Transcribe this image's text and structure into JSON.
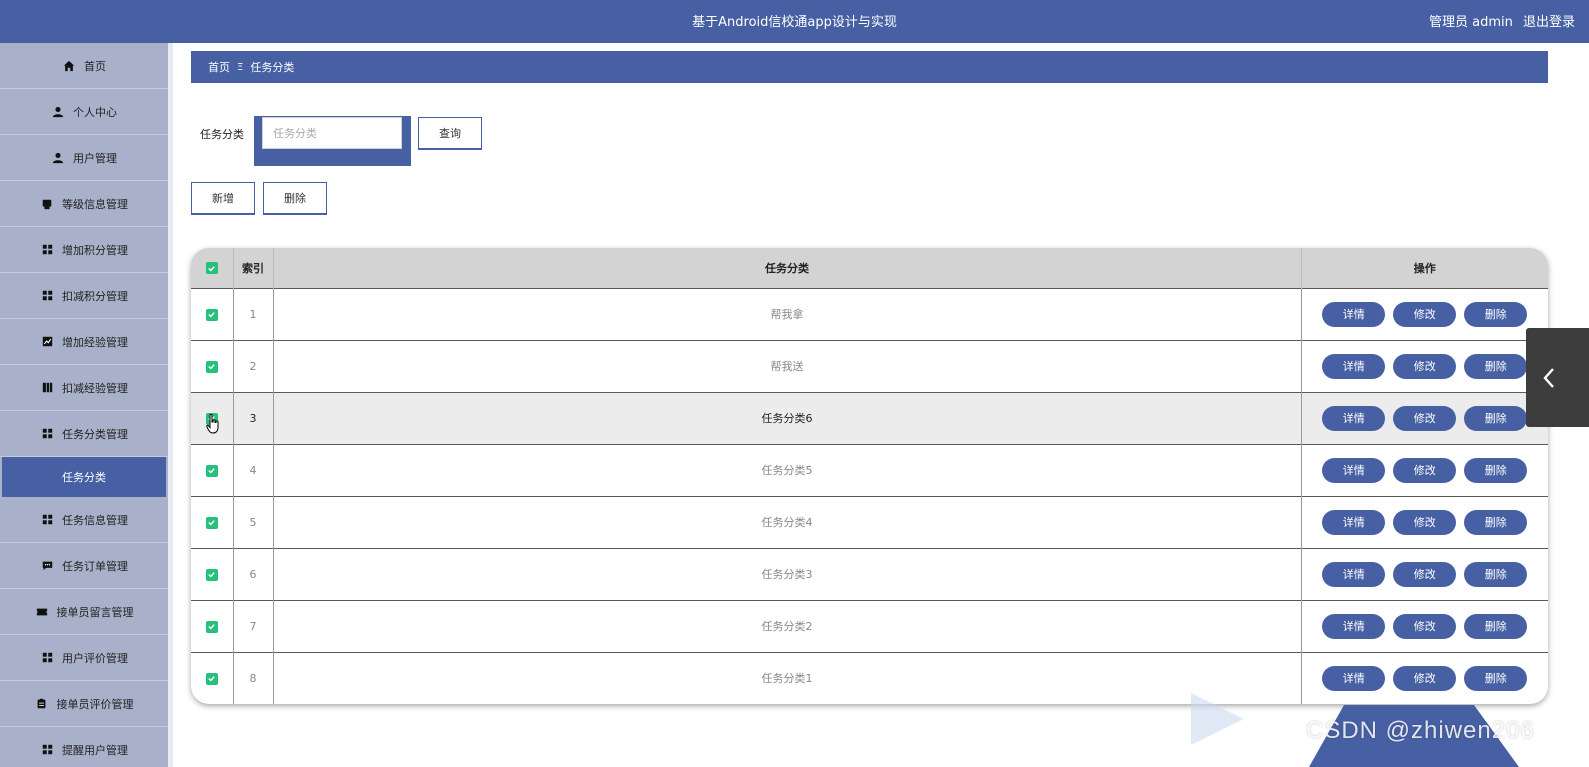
{
  "header": {
    "title": "基于Android信校通app设计与实现",
    "user_text": "管理员 admin",
    "logout": "退出登录"
  },
  "sidebar": {
    "items": [
      {
        "label": "首页",
        "icon": "home-icon"
      },
      {
        "label": "个人中心",
        "icon": "person-icon"
      },
      {
        "label": "用户管理",
        "icon": "person-icon"
      },
      {
        "label": "等级信息管理",
        "icon": "printer-icon"
      },
      {
        "label": "增加积分管理",
        "icon": "grid-icon"
      },
      {
        "label": "扣减积分管理",
        "icon": "grid-icon"
      },
      {
        "label": "增加经验管理",
        "icon": "chart-icon"
      },
      {
        "label": "扣减经验管理",
        "icon": "book-icon"
      },
      {
        "label": "任务分类管理",
        "icon": "grid-icon"
      },
      {
        "label": "任务分类",
        "icon": "",
        "active": true
      },
      {
        "label": "任务信息管理",
        "icon": "grid-icon"
      },
      {
        "label": "任务订单管理",
        "icon": "chat-icon"
      },
      {
        "label": "接单员留言管理",
        "icon": "ticket-icon"
      },
      {
        "label": "用户评价管理",
        "icon": "grid-icon"
      },
      {
        "label": "接单员评价管理",
        "icon": "clipboard-icon"
      },
      {
        "label": "提醒用户管理",
        "icon": "grid-icon"
      }
    ]
  },
  "breadcrumb": {
    "home": "首页",
    "separator": "Ξ",
    "current": "任务分类"
  },
  "search": {
    "label": "任务分类",
    "placeholder": "任务分类",
    "value": "",
    "query_button": "查询"
  },
  "toolbar": {
    "add": "新增",
    "delete": "删除"
  },
  "table": {
    "headers": {
      "index": "索引",
      "category": "任务分类",
      "ops": "操作"
    },
    "rows": [
      {
        "index": "1",
        "category": "帮我拿"
      },
      {
        "index": "2",
        "category": "帮我送"
      },
      {
        "index": "3",
        "category": "任务分类6"
      },
      {
        "index": "4",
        "category": "任务分类5"
      },
      {
        "index": "5",
        "category": "任务分类4"
      },
      {
        "index": "6",
        "category": "任务分类3"
      },
      {
        "index": "7",
        "category": "任务分类2"
      },
      {
        "index": "8",
        "category": "任务分类1"
      }
    ],
    "ops": {
      "detail": "详情",
      "edit": "修改",
      "delete": "删除"
    }
  },
  "watermark": {
    "text": "CSDN @zhiwen206"
  },
  "colors": {
    "primary": "#4760a4",
    "sidebar_bg": "#a8b1c9",
    "checkbox": "#27c07a"
  }
}
